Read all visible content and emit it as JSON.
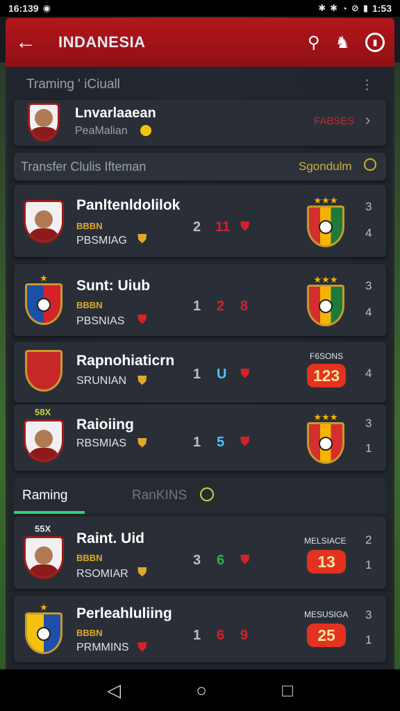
{
  "status_bar": {
    "time_left": "16:139",
    "time_right": "1:53",
    "icons": [
      "bluetooth-icon",
      "bluetooth-icon",
      "wifi-icon",
      "alarm-icon",
      "battery-icon"
    ]
  },
  "app_bar": {
    "title": "INDANESIA",
    "colors": {
      "accent": "#b3161b"
    }
  },
  "training_section": {
    "title": "Traming ' iCiuall",
    "more": "⋮"
  },
  "profile_card": {
    "name": "Lnvarlaaean",
    "sub": "PeaMalian",
    "status": "FABSES",
    "chevron": "›"
  },
  "transfer_section": {
    "title": "Transfer Clulis Ifteman",
    "right_label": "Sgondulm"
  },
  "club_cards": [
    {
      "name": "Panltenldolilok",
      "tag": "BBBN",
      "sub": "PBSMIAG",
      "score_a": "2",
      "score_b": "11",
      "side_top": "3",
      "side_bottom": "4"
    },
    {
      "name": "Sunt: Uiub",
      "tag": "BBBN",
      "sub": "PBSNIAS",
      "score_a": "1",
      "score_b": "2",
      "score_c": "8",
      "side_top": "3",
      "side_bottom": "4"
    },
    {
      "name": "Rapnohiaticrn",
      "tag": "",
      "sub": "SRUNIAN",
      "score_a": "1",
      "score_b": "U",
      "badge_label": "F6SONS",
      "badge": "123",
      "side_top": "",
      "side_bottom": "4"
    },
    {
      "name": "Raioiing",
      "tag": "58X",
      "sub": "RBSMIAS",
      "score_a": "1",
      "score_b": "5",
      "side_top": "3",
      "side_bottom": "1"
    }
  ],
  "tabs": {
    "active": "Raming",
    "inactive": "RanKINS"
  },
  "ranking_cards": [
    {
      "name": "Raint. Uid",
      "tag_top": "55X",
      "tag": "BBBN",
      "sub": "RSOMIAR",
      "score_a": "3",
      "score_b": "6",
      "badge_label": "MELSIACE",
      "badge": "13",
      "side_top": "2",
      "side_bottom": "1"
    },
    {
      "name": "Perleahluliing",
      "tag": "BBBN",
      "sub": "PRMMINS",
      "score_a": "1",
      "score_b": "6",
      "score_c": "9",
      "badge_label": "MESUSIGA",
      "badge": "25",
      "side_top": "3",
      "side_bottom": "1"
    }
  ]
}
